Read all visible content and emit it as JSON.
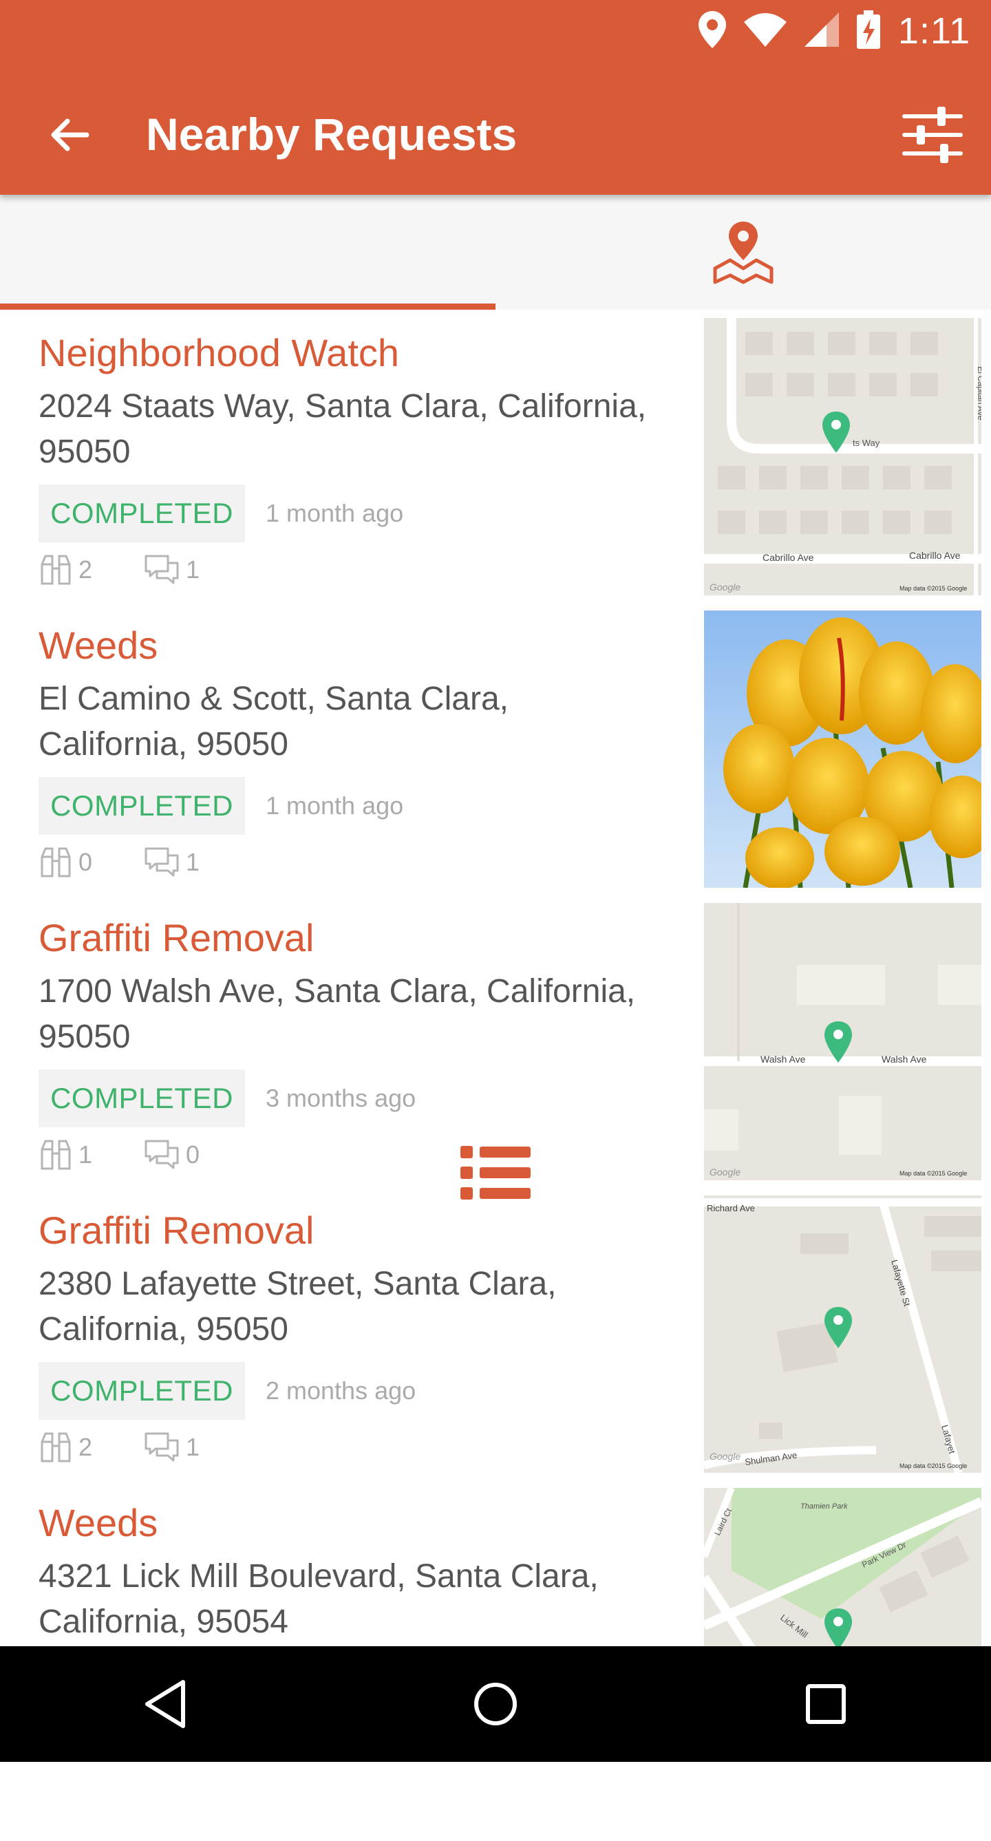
{
  "status_bar": {
    "time": "1:11"
  },
  "app_bar": {
    "title": "Nearby Requests"
  },
  "tabs": [
    {
      "name": "list",
      "icon": "list-icon",
      "selected": true
    },
    {
      "name": "map",
      "icon": "map-pin-icon",
      "selected": false
    }
  ],
  "colors": {
    "accent": "#d95a36",
    "status_green": "#3fb26b",
    "pin_green": "#3dbb7e"
  },
  "requests": [
    {
      "title": "Neighborhood Watch",
      "address": "2024  Staats Way, Santa Clara, California, 95050",
      "status": "COMPLETED",
      "time": "1 month ago",
      "watchers": "2",
      "comments": "1",
      "thumb": "map",
      "map_labels": {
        "street_a": "ts Way",
        "street_b": "Cabrillo Ave",
        "street_c": "Cabrillo Ave",
        "street_d": "El Capitan Ave",
        "logo": "Google",
        "credit": "Map data ©2015 Google"
      }
    },
    {
      "title": "Weeds",
      "address": "El Camino & Scott, Santa Clara, California, 95050",
      "status": "COMPLETED",
      "time": "1 month ago",
      "watchers": "0",
      "comments": "1",
      "thumb": "photo"
    },
    {
      "title": "Graffiti Removal",
      "address": "1700  Walsh Ave, Santa Clara, California, 95050",
      "status": "COMPLETED",
      "time": "3 months ago",
      "watchers": "1",
      "comments": "0",
      "thumb": "map",
      "map_labels": {
        "street_a": "Walsh Ave",
        "street_b": "Walsh Ave",
        "logo": "Google",
        "credit": "Map data ©2015 Google"
      }
    },
    {
      "title": "Graffiti Removal",
      "address": "2380  Lafayette Street, Santa Clara, California, 95050",
      "status": "COMPLETED",
      "time": "2 months ago",
      "watchers": "2",
      "comments": "1",
      "thumb": "map",
      "map_labels": {
        "street_a": "Richard Ave",
        "street_b": "Lafayette St",
        "street_c": "Lafayet",
        "street_d": "Shulman Ave",
        "logo": "Google",
        "credit": "Map data ©2015 Google"
      }
    },
    {
      "title": "Weeds",
      "address": "4321  Lick Mill Boulevard, Santa Clara, California, 95054",
      "status": "",
      "time": "",
      "watchers": "",
      "comments": "",
      "thumb": "map",
      "map_labels": {
        "street_a": "Thamien Park",
        "street_b": "Park View Dr",
        "street_c": "Laird Ct",
        "street_d": "Lick Mill"
      }
    }
  ],
  "nav_bar": {
    "back": "back-triangle-icon",
    "home": "home-circle-icon",
    "recents": "recents-square-icon"
  }
}
